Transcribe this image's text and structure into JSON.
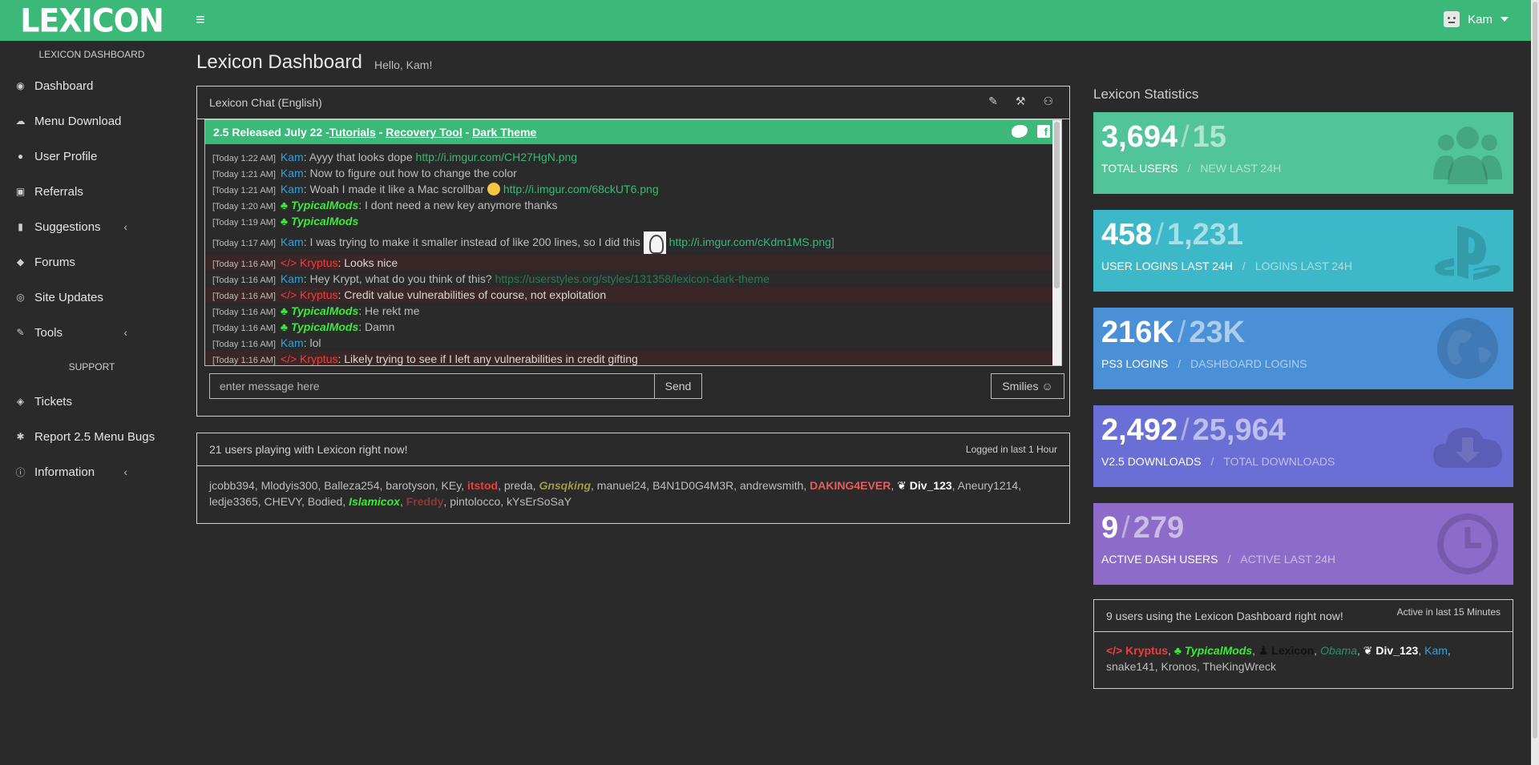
{
  "app": {
    "logo": "LEXICON",
    "hamburger": "≡",
    "user_name": "Kam"
  },
  "sidebar": {
    "header": "LEXICON DASHBOARD",
    "support_header": "SUPPORT",
    "items": [
      {
        "label": "Dashboard",
        "icon": "dashboard-icon",
        "glyph": "◉"
      },
      {
        "label": "Menu Download",
        "icon": "cloud-download-icon",
        "glyph": "☁"
      },
      {
        "label": "User Profile",
        "icon": "user-icon",
        "glyph": "●"
      },
      {
        "label": "Referrals",
        "icon": "gift-icon",
        "glyph": "▣"
      },
      {
        "label": "Suggestions",
        "icon": "microphone-icon",
        "glyph": "▮",
        "chevron": "‹"
      },
      {
        "label": "Forums",
        "icon": "comments-icon",
        "glyph": "◆"
      },
      {
        "label": "Site Updates",
        "icon": "github-icon",
        "glyph": "◎"
      },
      {
        "label": "Tools",
        "icon": "wrench-icon",
        "glyph": "✎",
        "chevron": "‹"
      }
    ],
    "support_items": [
      {
        "label": "Tickets",
        "icon": "tag-icon",
        "glyph": "◈"
      },
      {
        "label": "Report 2.5 Menu Bugs",
        "icon": "bug-icon",
        "glyph": "✱"
      },
      {
        "label": "Information",
        "icon": "info-icon",
        "glyph": "ⓘ",
        "chevron": "‹"
      }
    ]
  },
  "page": {
    "title": "Lexicon Dashboard",
    "subtitle": "Hello, Kam!"
  },
  "chat": {
    "title": "Lexicon Chat (English)",
    "tools": [
      "✎",
      "⚒",
      "⚇"
    ],
    "banner": {
      "prefix": "2.5 Released July 22 - ",
      "link1": "Tutorials",
      "sep1": " - ",
      "link2": "Recovery Tool",
      "sep2": " - ",
      "link3": "Dark Theme",
      "fb": "f"
    },
    "input_placeholder": "enter message here",
    "send_label": "Send",
    "smilies_label": "Smilies ☺",
    "messages": [
      {
        "ts": "[Today 1:22 AM]",
        "name": "Kam",
        "cls": "n-kam",
        "text": ": Ayyy that looks dope ",
        "link": "http://i.imgur.com/CH27HgN.png"
      },
      {
        "ts": "[Today 1:21 AM]",
        "name": "Kam",
        "cls": "n-kam",
        "text": ": Now to figure out how to change the color"
      },
      {
        "ts": "[Today 1:21 AM]",
        "name": "Kam",
        "cls": "n-kam",
        "text": ": Woah I made it like a Mac scrollbar ",
        "emoji": true,
        "link": "http://i.imgur.com/68ckUT6.png"
      },
      {
        "ts": "[Today 1:20 AM]",
        "name": "♣ TypicalMods",
        "cls": "n-typ",
        "text": ": I dont need a new key anymore thanks"
      },
      {
        "ts": "[Today 1:19 AM]",
        "name": "♣ TypicalMods",
        "cls": "n-typ",
        "text": ""
      },
      {
        "ts": "[Today 1:17 AM]",
        "name": "Kam",
        "cls": "n-kam",
        "text": ": I was trying to make it smaller instead of like 200 lines, so I did this ",
        "img": true,
        "link": "http://i.imgur.com/cKdm1MS.png]",
        "tall": true
      },
      {
        "ts": "[Today 1:16 AM]",
        "name": "</> Kryptus",
        "cls": "n-kry",
        "text": ": Looks nice",
        "red": true
      },
      {
        "ts": "[Today 1:16 AM]",
        "name": "Kam",
        "cls": "n-kam",
        "text": ": Hey Krypt, what do you think of this? ",
        "link_dim": "https://userstyles.org/styles/131358/lexicon-dark-theme"
      },
      {
        "ts": "[Today 1:16 AM]",
        "name": "</> Kryptus",
        "cls": "n-kry",
        "text": ": Credit value vulnerabilities of course, not exploitation",
        "red": true
      },
      {
        "ts": "[Today 1:16 AM]",
        "name": "♣ TypicalMods",
        "cls": "n-typ",
        "text": ": He rekt me"
      },
      {
        "ts": "[Today 1:16 AM]",
        "name": "♣ TypicalMods",
        "cls": "n-typ",
        "text": ": Damn"
      },
      {
        "ts": "[Today 1:16 AM]",
        "name": "Kam",
        "cls": "n-kam",
        "text": ": lol"
      },
      {
        "ts": "[Today 1:16 AM]",
        "name": "</> Kryptus",
        "cls": "n-kry",
        "text": ": Likely trying to see if I left any vulnerabilities in credit gifting",
        "red": true
      }
    ]
  },
  "playing": {
    "title": "21 users playing with Lexicon right now!",
    "right": "Logged in last 1 Hour",
    "users": [
      {
        "n": "jcobb394",
        "c": ""
      },
      {
        "n": "Mlodyis300",
        "c": ""
      },
      {
        "n": "Balleza254",
        "c": ""
      },
      {
        "n": "barotyson",
        "c": ""
      },
      {
        "n": "KEy",
        "c": ""
      },
      {
        "n": "itstod",
        "c": "u-red"
      },
      {
        "n": "preda",
        "c": ""
      },
      {
        "n": "Gnsqking",
        "c": "u-gold"
      },
      {
        "n": "manuel24",
        "c": ""
      },
      {
        "n": "B4N1D0G4M3R",
        "c": ""
      },
      {
        "n": "andrewsmith",
        "c": ""
      },
      {
        "n": "DAKING4EVER",
        "c": "u-crimson"
      },
      {
        "n": "❦ Div_123",
        "c": "u-white"
      },
      {
        "n": "Aneury1214",
        "c": ""
      },
      {
        "n": "ledje3365",
        "c": ""
      },
      {
        "n": "CHEVY",
        "c": ""
      },
      {
        "n": "Bodied",
        "c": ""
      },
      {
        "n": "Islamicox",
        "c": "u-green"
      },
      {
        "n": "Freddy",
        "c": "u-faded"
      },
      {
        "n": "pintolocco",
        "c": ""
      },
      {
        "n": "kYsErSoSaY",
        "c": ""
      }
    ]
  },
  "stats": {
    "title": "Lexicon Statistics",
    "cards": [
      {
        "v1": "3,694",
        "v2": "15",
        "l1": "TOTAL USERS",
        "l2": "NEW LAST 24H",
        "color": "#52c49a",
        "icon": "users-icon"
      },
      {
        "v1": "458",
        "v2": "1,231",
        "l1": "USER LOGINS LAST 24H",
        "l2": "LOGINS LAST 24H",
        "color": "#3db8c8",
        "icon": "playstation-icon"
      },
      {
        "v1": "216K",
        "v2": "23K",
        "l1": "PS3 LOGINS",
        "l2": "DASHBOARD LOGINS",
        "color": "#4a90d6",
        "icon": "globe-icon"
      },
      {
        "v1": "2,492",
        "v2": "25,964",
        "l1": "v2.5 DOWNLOADS",
        "l2": "TOTAL DOWNLOADS",
        "color": "#6a6fd6",
        "icon": "cloud-download-icon"
      },
      {
        "v1": "9",
        "v2": "279",
        "l1": "ACTIVE DASH USERS",
        "l2": "ACTIVE LAST 24H",
        "color": "#8c6cc8",
        "icon": "clock-icon"
      }
    ]
  },
  "online": {
    "title": "9 users using the Lexicon Dashboard right now!",
    "right": "Active in last 15 Minutes",
    "users": [
      {
        "n": "</> Kryptus",
        "c": "u-red"
      },
      {
        "n": "♣ TypicalMods",
        "c": "u-green"
      },
      {
        "n": "♟ Lexicon",
        "c": "u-black"
      },
      {
        "n": "Obama",
        "c": "u-teal"
      },
      {
        "n": "❦ Div_123",
        "c": "u-white"
      },
      {
        "n": "Kam",
        "c": "u-blue"
      },
      {
        "n": "snake141",
        "c": ""
      },
      {
        "n": "Kronos",
        "c": ""
      },
      {
        "n": "TheKingWreck",
        "c": ""
      }
    ]
  }
}
